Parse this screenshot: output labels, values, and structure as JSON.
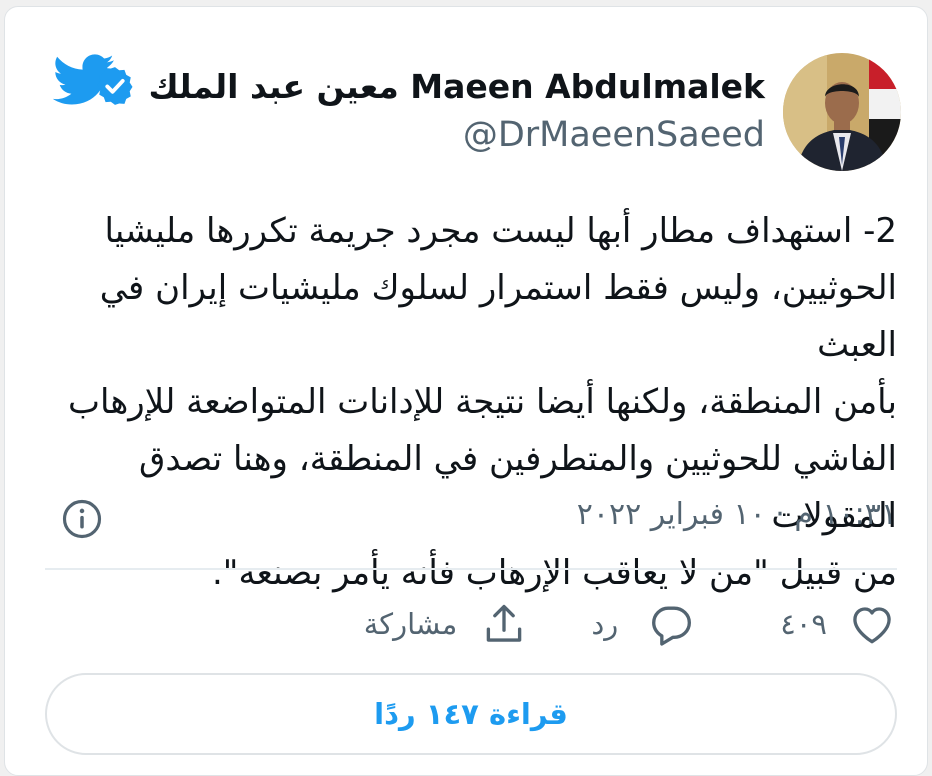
{
  "author": {
    "display_name": "معين عبد الملك Maeen Abdulmalek",
    "handle": "@DrMaeenSaeed",
    "verified": true
  },
  "tweet": {
    "text_lines": [
      "2- استهداف مطار أبها ليست مجرد جريمة تكررها مليشيا",
      "الحوثيين، وليس فقط استمرار لسلوك مليشيات إيران في العبث",
      "بأمن المنطقة، ولكنها أيضا نتيجة للإدانات المتواضعة للإرهاب",
      "الفاشي للحوثيين والمتطرفين في المنطقة، وهنا تصدق المقولات",
      "من قبيل \"من لا يعاقب الإرهاب فأنه يأمر بصنعه\"."
    ],
    "timestamp": "١٠:٣١ م · ١٠ فبراير ٢٠٢٢"
  },
  "actions": {
    "like_count": "٤٠٩",
    "reply_label": "رد",
    "share_label": "مشاركة"
  },
  "read_replies_label": "قراءة ١٤٧ ردًا",
  "icons": {
    "logo": "twitter-bird-icon",
    "verified": "verified-badge-icon",
    "info": "info-icon",
    "like": "heart-icon",
    "reply": "speech-bubble-icon",
    "share": "share-upload-icon"
  },
  "colors": {
    "brand_blue": "#1d9bf0",
    "text": "#0f1419",
    "secondary_text": "#536471",
    "divider": "#e6ecf0"
  }
}
